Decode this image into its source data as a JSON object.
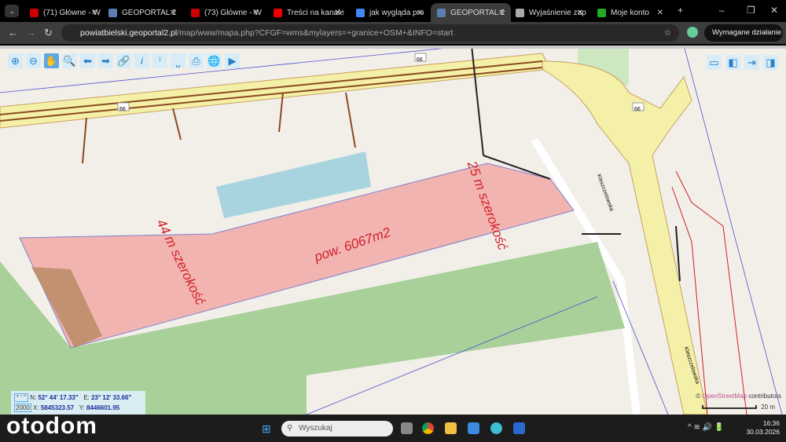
{
  "tabs": [
    {
      "label": "(71) Główne - W",
      "color": "#c00"
    },
    {
      "label": "GEOPORTAL 2",
      "color": "#5a7fb0"
    },
    {
      "label": "(73) Główne - W",
      "color": "#c00"
    },
    {
      "label": "Treści na kanale",
      "color": "#e00"
    },
    {
      "label": "jak wygląda pro",
      "color": "#4285f4"
    },
    {
      "label": "GEOPORTAL 2",
      "color": "#5a7fb0",
      "active": true
    },
    {
      "label": "Wyjaśnienie zap",
      "color": "#aaa"
    },
    {
      "label": "Moje konto",
      "color": "#2a2"
    }
  ],
  "url": {
    "host": "powiatbielski.geoportal2.pl",
    "path": "/map/www/mapa.php?CFGF=wms&mylayers=+granice+OSM+&INFO=start"
  },
  "action_button": "Wymagane działanie",
  "map": {
    "area_label": "pow. 6067m2",
    "width_left": "44 m szerokość",
    "width_right": "25 m szerokość",
    "road_number": "66",
    "street_name": "Kleszczelowska",
    "coords": {
      "sys1": "° ' \"",
      "n_label": "N:",
      "n": "52° 44' 17.33\"",
      "e_label": "E:",
      "e": "23° 12' 33.66\"",
      "sys2": "2000",
      "x_label": "X:",
      "x": "5845323.57",
      "y_label": "Y:",
      "y": "8446601.95"
    },
    "attribution_prefix": "© ",
    "attribution_link": "OpenStreetMap",
    "attribution_suffix": " contributors",
    "scale": "20 m"
  },
  "taskbar": {
    "logo": "otodom",
    "search": "Wyszukaj",
    "time": "16:36",
    "date": "30.03.2026"
  }
}
